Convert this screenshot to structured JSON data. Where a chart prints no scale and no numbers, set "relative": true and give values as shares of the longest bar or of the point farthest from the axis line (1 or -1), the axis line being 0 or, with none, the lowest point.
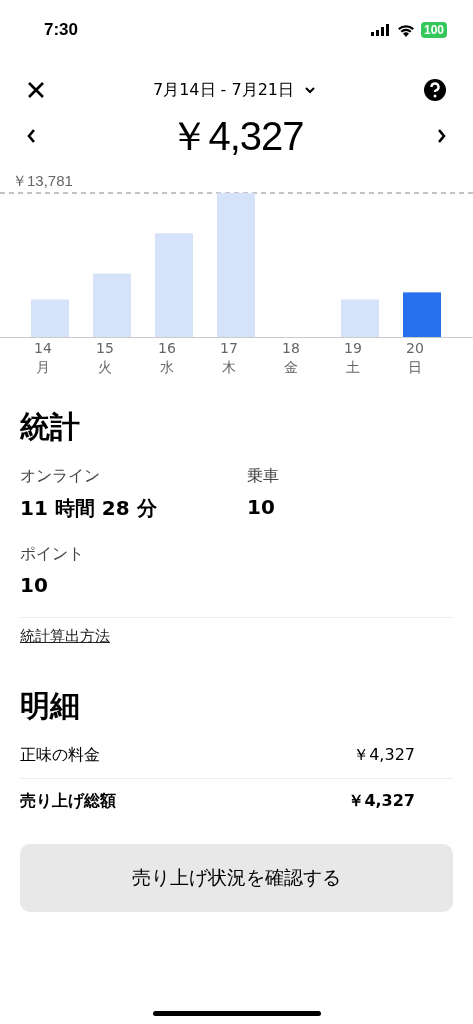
{
  "status_bar": {
    "time": "7:30",
    "battery": "100"
  },
  "header": {
    "date_range": "7月14日 - 7月21日"
  },
  "total": {
    "amount": "￥4,327"
  },
  "chart": {
    "chart_data": {
      "type": "bar",
      "categories": [
        "14",
        "15",
        "16",
        "17",
        "18",
        "19",
        "20"
      ],
      "series": [
        {
          "color": "#d5e2fa",
          "values": [
            0.26,
            0.44,
            0.72,
            1,
            0,
            0.26,
            null
          ]
        },
        {
          "color": "#2871ee",
          "values": [
            null,
            null,
            null,
            null,
            null,
            null,
            0.31
          ]
        }
      ],
      "stacked": true,
      "relative": true,
      "annotations": [
        {
          "text": "￥13,781"
        }
      ]
    },
    "weekdays": [
      "月",
      "火",
      "水",
      "木",
      "金",
      "土",
      "日"
    ]
  },
  "stats": {
    "title": "統計",
    "items": [
      {
        "label": "オンライン",
        "value": "11 時間 28 分"
      },
      {
        "label": "乗車",
        "value": "10"
      },
      {
        "label": "ポイント",
        "value": "10"
      }
    ],
    "link": "統計算出方法"
  },
  "breakdown": {
    "title": "明細",
    "rows": [
      {
        "label": "正味の料金",
        "value": "￥4,327",
        "bold": false
      },
      {
        "label": "売り上げ総額",
        "value": "￥4,327",
        "bold": true
      }
    ]
  },
  "button": "売り上げ状況を確認する"
}
